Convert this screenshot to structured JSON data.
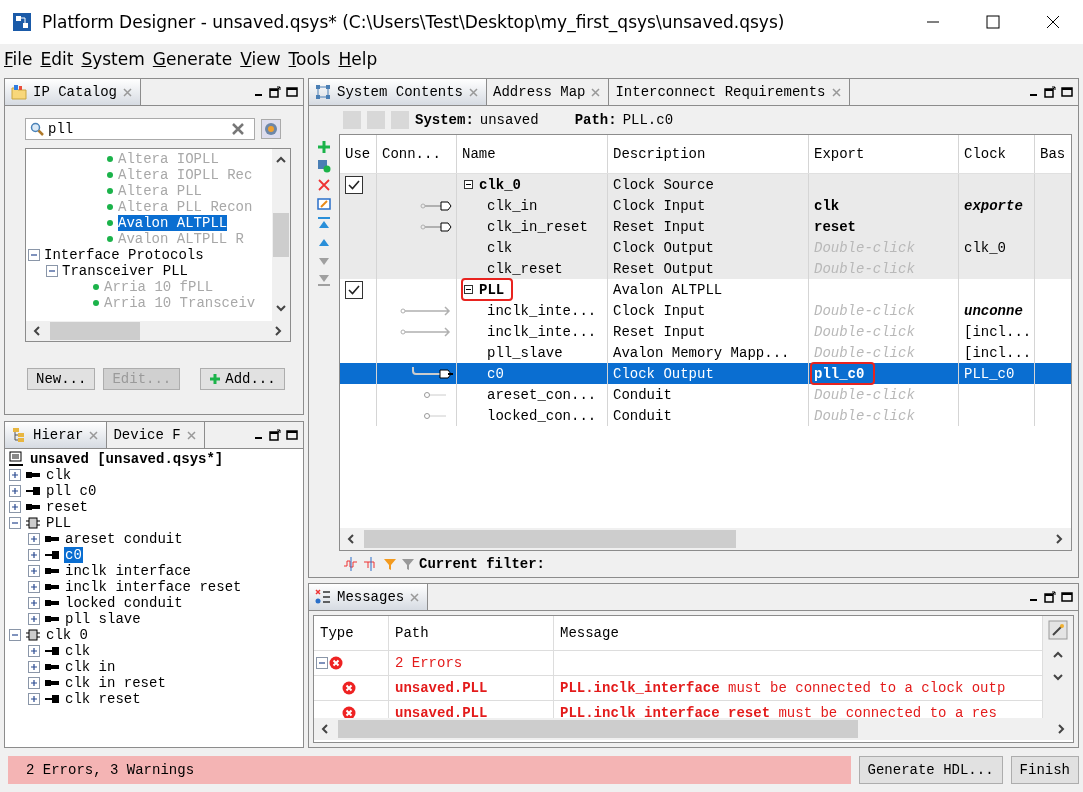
{
  "window": {
    "title": "Platform Designer - unsaved.qsys* (C:\\Users\\Test\\Desktop\\my_first_qsys\\unsaved.qsys)"
  },
  "menu": [
    "File",
    "Edit",
    "System",
    "Generate",
    "View",
    "Tools",
    "Help"
  ],
  "ip_catalog": {
    "tabs": [
      {
        "label": "IP Catalog",
        "selected": true
      }
    ],
    "search": {
      "value": "pll"
    },
    "tree": [
      {
        "kind": "ip",
        "label": "Altera IOPLL",
        "available": false,
        "selected": false
      },
      {
        "kind": "ip",
        "label": "Altera IOPLL Rec",
        "available": false,
        "selected": false
      },
      {
        "kind": "ip",
        "label": "Altera PLL",
        "available": false,
        "selected": false
      },
      {
        "kind": "ip",
        "label": "Altera PLL Recon",
        "available": false,
        "selected": false
      },
      {
        "kind": "ip",
        "label": "Avalon ALTPLL",
        "available": true,
        "selected": true
      },
      {
        "kind": "ip",
        "label": "Avalon ALTPLL R",
        "available": false,
        "selected": false
      },
      {
        "kind": "folder",
        "label": "Interface Protocols",
        "expanded": true,
        "children": [
          {
            "kind": "folder",
            "label": "Transceiver PLL",
            "expanded": true,
            "children": [
              {
                "kind": "ip",
                "label": "Arria 10 fPLL",
                "available": false,
                "selected": false
              },
              {
                "kind": "ip",
                "label": "Arria 10 Transceiv",
                "available": false,
                "selected": false
              }
            ]
          }
        ]
      }
    ],
    "buttons": [
      {
        "label": "New...",
        "disabled": false,
        "kind": "plain"
      },
      {
        "label": "Edit...",
        "disabled": true,
        "kind": "plain"
      },
      {
        "label": "Add...",
        "disabled": false,
        "kind": "add"
      }
    ]
  },
  "hierarchy": {
    "tabs": [
      {
        "label": "Hierar",
        "selected": true
      },
      {
        "label": "Device F",
        "selected": false
      }
    ],
    "root": {
      "label": "unsaved [unsaved.qsys*]",
      "children": [
        {
          "kind": "in",
          "label": "clk",
          "expanded": false,
          "selected": false
        },
        {
          "kind": "out",
          "label": "pll c0",
          "expanded": false,
          "selected": false
        },
        {
          "kind": "in",
          "label": "reset",
          "expanded": false,
          "selected": false
        },
        {
          "kind": "module",
          "label": "PLL",
          "expanded": true,
          "selected": false,
          "children": [
            {
              "kind": "in",
              "label": "areset conduit",
              "expanded": false,
              "selected": false
            },
            {
              "kind": "out",
              "label": "c0",
              "expanded": false,
              "selected": true
            },
            {
              "kind": "in",
              "label": "inclk interface",
              "expanded": false,
              "selected": false
            },
            {
              "kind": "in",
              "label": "inclk interface reset",
              "expanded": false,
              "selected": false
            },
            {
              "kind": "in",
              "label": "locked conduit",
              "expanded": false,
              "selected": false
            },
            {
              "kind": "in",
              "label": "pll slave",
              "expanded": false,
              "selected": false
            }
          ]
        },
        {
          "kind": "module",
          "label": "clk 0",
          "expanded": true,
          "selected": false,
          "children": [
            {
              "kind": "out",
              "label": "clk",
              "expanded": false,
              "selected": false
            },
            {
              "kind": "in",
              "label": "clk in",
              "expanded": false,
              "selected": false
            },
            {
              "kind": "in",
              "label": "clk in reset",
              "expanded": false,
              "selected": false
            },
            {
              "kind": "out",
              "label": "clk reset",
              "expanded": false,
              "selected": false
            }
          ]
        }
      ]
    }
  },
  "system_contents": {
    "tabs": [
      {
        "label": "System Contents",
        "selected": true
      },
      {
        "label": "Address Map",
        "selected": false
      },
      {
        "label": "Interconnect Requirements",
        "selected": false
      }
    ],
    "system_label": "System:",
    "system": "unsaved",
    "path_label": "Path:",
    "path": "PLL.c0",
    "columns": [
      "Use",
      "Conn...",
      "Name",
      "Description",
      "Export",
      "Clock",
      "Bas"
    ],
    "modules": [
      {
        "name": "clk_0",
        "description": "Clock Source",
        "use": true,
        "expanded": true,
        "shaded": true,
        "highlighted": false,
        "interfaces": [
          {
            "name": "clk_in",
            "description": "Clock Input",
            "kind": "socket",
            "export": {
              "text": "clk",
              "placeholder": false
            },
            "export_highlighted": false,
            "clock": {
              "text": "exporte",
              "emphasis": true
            },
            "selected": false
          },
          {
            "name": "clk_in_reset",
            "description": "Reset Input",
            "kind": "socket",
            "export": {
              "text": "reset",
              "placeholder": false
            },
            "export_highlighted": false,
            "selected": false
          },
          {
            "name": "clk",
            "description": "Clock Output",
            "kind": "none",
            "export": {
              "text": "Double-click",
              "placeholder": true
            },
            "export_highlighted": false,
            "clock": {
              "text": "clk_0",
              "emphasis": false
            },
            "selected": false
          },
          {
            "name": "clk_reset",
            "description": "Reset Output",
            "kind": "none",
            "export": {
              "text": "Double-click",
              "placeholder": true
            },
            "export_highlighted": false,
            "selected": false
          }
        ]
      },
      {
        "name": "PLL",
        "description": "Avalon ALTPLL",
        "use": true,
        "expanded": true,
        "shaded": false,
        "highlighted": true,
        "interfaces": [
          {
            "name": "inclk_inte...",
            "description": "Clock Input",
            "kind": "arrow",
            "export": {
              "text": "Double-click",
              "placeholder": true
            },
            "export_highlighted": false,
            "clock": {
              "text": "unconne",
              "emphasis": true
            },
            "selected": false
          },
          {
            "name": "inclk_inte...",
            "description": "Reset Input",
            "kind": "arrow",
            "export": {
              "text": "Double-click",
              "placeholder": true
            },
            "export_highlighted": false,
            "clock": {
              "text": "[incl...",
              "emphasis": false
            },
            "selected": false
          },
          {
            "name": "pll_slave",
            "description": "Avalon Memory Mapp...",
            "kind": "none",
            "export": {
              "text": "Double-click",
              "placeholder": true
            },
            "export_highlighted": false,
            "clock": {
              "text": "[incl...",
              "emphasis": false
            },
            "selected": false
          },
          {
            "name": "c0",
            "description": "Clock Output",
            "kind": "plug",
            "export": {
              "text": "pll_c0",
              "placeholder": false
            },
            "export_highlighted": true,
            "clock": {
              "text": "PLL_c0",
              "emphasis": false
            },
            "selected": true
          },
          {
            "name": "areset_con...",
            "description": "Conduit",
            "kind": "dot",
            "export": {
              "text": "Double-click",
              "placeholder": true
            },
            "export_highlighted": false,
            "selected": false
          },
          {
            "name": "locked_con...",
            "description": "Conduit",
            "kind": "dot",
            "export": {
              "text": "Double-click",
              "placeholder": true
            },
            "export_highlighted": false,
            "selected": false
          }
        ]
      }
    ],
    "filter_label": "Current filter:"
  },
  "messages": {
    "tabs": [
      {
        "label": "Messages",
        "selected": true
      }
    ],
    "columns": [
      "Type",
      "Path",
      "Message"
    ],
    "groups": [
      {
        "label": "2 Errors",
        "expanded": true,
        "messages": [
          {
            "path": "unsaved.PLL",
            "text": "**PLL.inclk_interface** must be connected to a clock outp"
          },
          {
            "path": "unsaved.PLL",
            "text": "**PLL.inclk_interface_reset** must be connected to a res"
          }
        ]
      }
    ]
  },
  "status_bar": {
    "text": "2 Errors, 3 Warnings",
    "has_errors": true,
    "buttons": [
      "Generate HDL...",
      "Finish"
    ]
  }
}
